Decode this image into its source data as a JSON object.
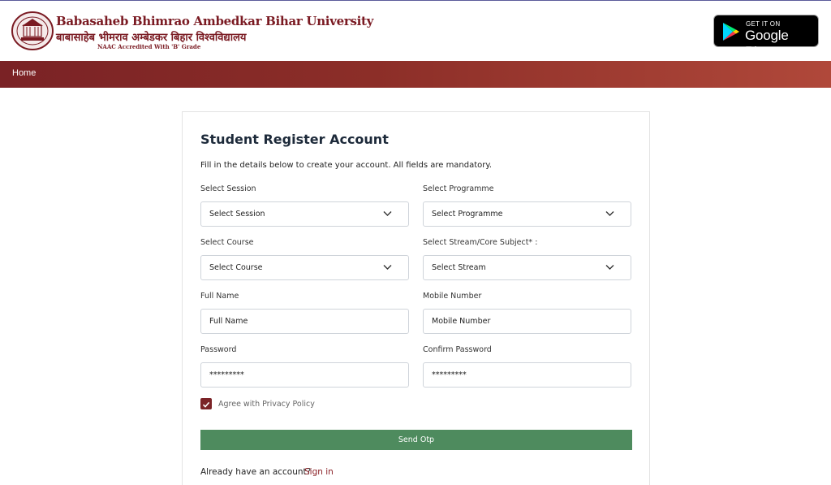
{
  "header": {
    "university_name": "Babasaheb Bhimrao Ambedkar Bihar University",
    "university_name_hindi": "बाबासाहेब भीमराव अम्बेडकर बिहार विश्वविद्यालय",
    "accreditation": "NAAC Accredited With 'B' Grade",
    "play_store": {
      "small": "GET IT ON",
      "big": "Google Play"
    }
  },
  "nav": {
    "home": "Home"
  },
  "form": {
    "title": "Student Register Account",
    "subtitle": "Fill in the details below to create your account. All fields are mandatory.",
    "session": {
      "label": "Select Session",
      "value": "Select Session"
    },
    "programme": {
      "label": "Select Programme",
      "value": "Select Programme"
    },
    "course": {
      "label": "Select Course",
      "value": "Select Course"
    },
    "stream": {
      "label": "Select Stream/Core Subject* :",
      "value": "Select Stream"
    },
    "full_name": {
      "label": "Full Name",
      "placeholder": "Full Name"
    },
    "mobile": {
      "label": "Mobile Number",
      "placeholder": "Mobile Number"
    },
    "password": {
      "label": "Password",
      "value": "*********"
    },
    "confirm_password": {
      "label": "Confirm Password",
      "value": "*********"
    },
    "privacy": {
      "label": "Agree with Privacy Policy",
      "checked": true
    },
    "submit": "Send Otp",
    "already": "Already have an account?",
    "signin": "Sign in"
  },
  "colors": {
    "brand": "#7a1a22",
    "nav_start": "#7a2225",
    "nav_end": "#b0483a",
    "submit_bg": "#4e8b5e",
    "checkbox": "#7b2327"
  },
  "icons": [
    "university-seal-icon",
    "google-play-icon",
    "chevron-down-icon",
    "checkmark-icon"
  ]
}
